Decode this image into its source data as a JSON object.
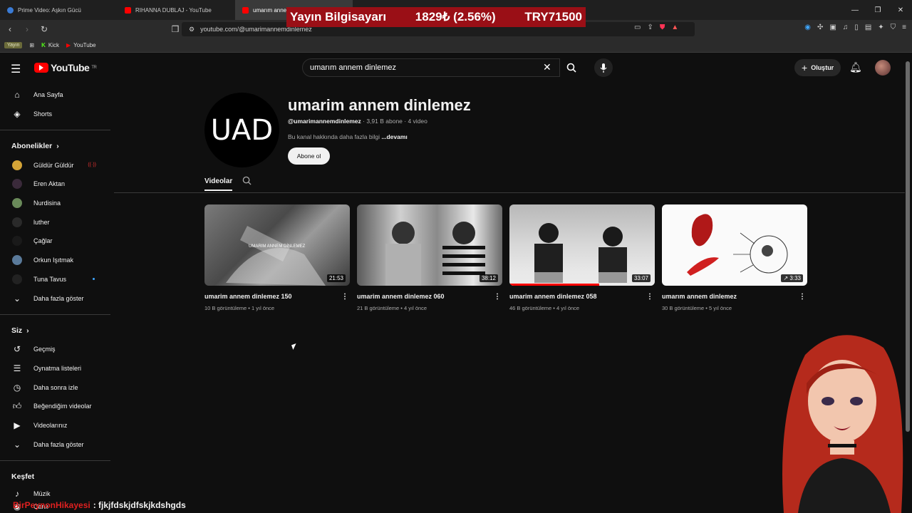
{
  "browser": {
    "tabs": [
      {
        "label": "Prime Video: Aşkın Gücü",
        "color": "#3a7bd5"
      },
      {
        "label": "RIHANNA DUBLAJ - YouTube",
        "color": "#ff0000"
      },
      {
        "label": "umarım anne...",
        "color": "#ff0000"
      }
    ],
    "url": "youtube.com/@umarimannemdinlemez",
    "bookmarks": {
      "badge": "Yayın",
      "kick": "Kick",
      "youtube": "YouTube"
    }
  },
  "overlay": {
    "left": "Yayın Bilgisayarı",
    "mid": "1829₺ (2.56%)",
    "right": "TRY71500"
  },
  "youtube": {
    "logo": "YouTube",
    "logo_region": "TR",
    "search_value": "umarım annem dinlemez",
    "create_label": "Oluştur"
  },
  "sidebar": {
    "home": "Ana Sayfa",
    "shorts": "Shorts",
    "subs_title": "Abonelikler",
    "subs": [
      {
        "label": "Güldür Güldür",
        "color": "#d4a437",
        "live": true
      },
      {
        "label": "Eren Aktan",
        "color": "#3a2a3a",
        "live": false
      },
      {
        "label": "Nurdisina",
        "color": "#6a8a5a",
        "live": false
      },
      {
        "label": "luther",
        "color": "#2a2a2a",
        "live": false
      },
      {
        "label": "Çağlar",
        "color": "#1a1a1a",
        "live": false
      },
      {
        "label": "Orkun Işıtmak",
        "color": "#5a7a9a",
        "live": false
      },
      {
        "label": "Tuna Tavus",
        "color": "#222",
        "dot": true
      }
    ],
    "more1": "Daha fazla göster",
    "you_title": "Siz",
    "you": [
      "Geçmiş",
      "Oynatma listeleri",
      "Daha sonra izle",
      "Beğendiğim videolar",
      "Videolarınız"
    ],
    "more2": "Daha fazla göster",
    "explore_title": "Keşfet",
    "music": "Müzik",
    "more3": "Canlı"
  },
  "channel": {
    "avatar_text": "UAD",
    "name": "umarim annem dinlemez",
    "handle": "@umarimannemdinlemez",
    "stats": "· 3,91 B abone · 4 video",
    "desc": "Bu kanal hakkında daha fazla bilgi",
    "desc_more": "...devamı",
    "subscribe": "Abone ol",
    "tab_videos": "Videolar"
  },
  "videos": [
    {
      "title": "umarim annem dinlemez 150",
      "meta": "10 B görüntüleme • 1 yıl önce",
      "duration": "21:53",
      "progress": 0
    },
    {
      "title": "umarim annem dinlemez 060",
      "meta": "21 B görüntüleme • 4 yıl önce",
      "duration": "38:12",
      "progress": 0
    },
    {
      "title": "umarim annem dinlemez 058",
      "meta": "46 B görüntüleme • 4 yıl önce",
      "duration": "33:07",
      "progress": 0.62
    },
    {
      "title": "umarım annem dinlemez",
      "meta": "30 B görüntüleme • 5 yıl önce",
      "duration": "3:33",
      "progress": 0
    }
  ],
  "ticker": {
    "who": "BirPeynonHikayesi",
    "msg": ": fjkjfdskjdfskjkdshgds"
  }
}
